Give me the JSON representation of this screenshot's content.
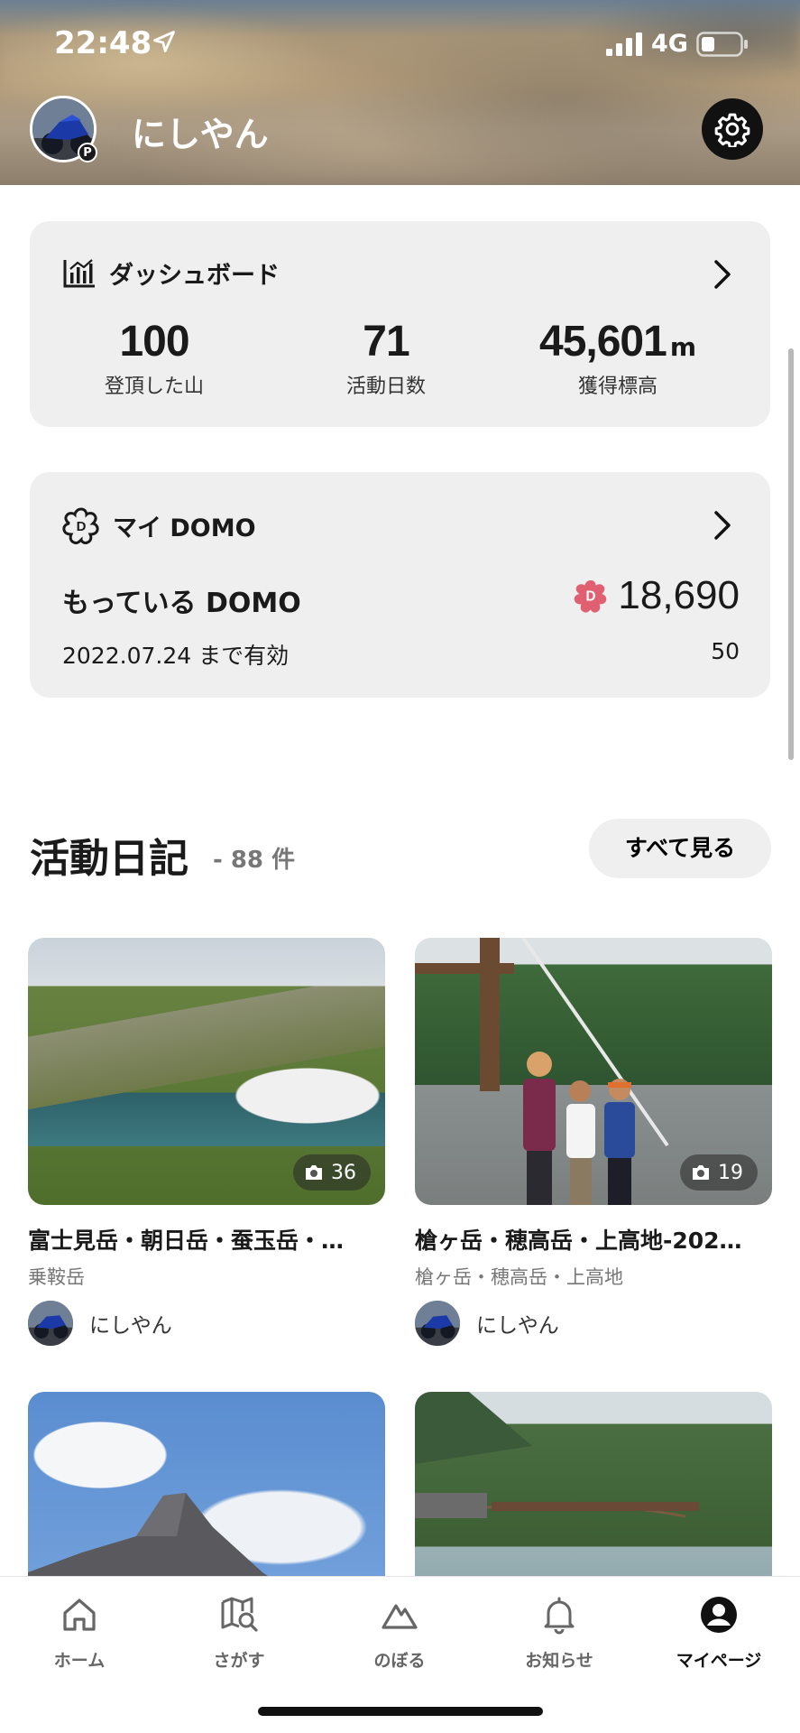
{
  "status": {
    "time": "22:48",
    "network": "4G"
  },
  "profile": {
    "name": "にしやん",
    "badge": "P"
  },
  "dashboard": {
    "title": "ダッシュボード",
    "stats": [
      {
        "value": "100",
        "unit": "",
        "label": "登頂した山"
      },
      {
        "value": "71",
        "unit": "",
        "label": "活動日数"
      },
      {
        "value": "45,601",
        "unit": "m",
        "label": "獲得標高"
      }
    ]
  },
  "domo": {
    "title": "マイ DOMO",
    "owned_label": "もっている DOMO",
    "amount": "18,690",
    "expire_label": "2022.07.24 まで有効",
    "expire_value": "50"
  },
  "diary": {
    "title": "活動日記",
    "count": "- 88 件",
    "see_all": "すべて見る",
    "items": [
      {
        "title": "富士見岳・朝日岳・蚕玉岳・…",
        "mountain": "乗鞍岳",
        "user": "にしやん",
        "photos": "36"
      },
      {
        "title": "槍ヶ岳・穂高岳・上高地-202…",
        "mountain": "槍ヶ岳・穂高岳・上高地",
        "user": "にしやん",
        "photos": "19"
      },
      {
        "title": "",
        "mountain": "",
        "user": "",
        "photos": ""
      },
      {
        "title": "",
        "mountain": "",
        "user": "",
        "photos": ""
      }
    ]
  },
  "tabs": [
    {
      "label": "ホーム",
      "icon": "home-icon"
    },
    {
      "label": "さがす",
      "icon": "map-search-icon"
    },
    {
      "label": "のぼる",
      "icon": "mountain-icon"
    },
    {
      "label": "お知らせ",
      "icon": "bell-icon"
    },
    {
      "label": "マイページ",
      "icon": "profile-icon"
    }
  ],
  "colors": {
    "accent": "#e06072",
    "text": "#1a1a1a",
    "card": "#efefef"
  }
}
